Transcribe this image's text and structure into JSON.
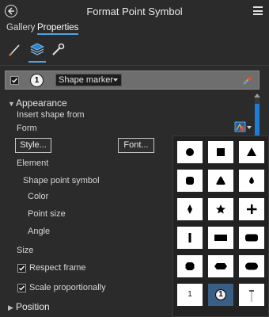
{
  "window": {
    "title": "Format Point Symbol"
  },
  "tabs": [
    {
      "label": "Gallery",
      "active": false
    },
    {
      "label": "Properties",
      "active": true
    }
  ],
  "subtabs": [
    {
      "icon": "brush-icon",
      "active": false
    },
    {
      "icon": "layers-icon",
      "active": true
    },
    {
      "icon": "wrench-icon",
      "active": false
    }
  ],
  "layer": {
    "checked": true,
    "badge": "1",
    "marker_type": "Shape marker"
  },
  "appearance": {
    "section_label": "Appearance",
    "insert_shape_label": "Insert shape from",
    "form_label": "Form",
    "style_button": "Style...",
    "font_button": "Font...",
    "element_label": "Element",
    "shape_point_symbol_label": "Shape point symbol",
    "color_label": "Color",
    "point_size_label": "Point size",
    "angle_label": "Angle",
    "size_label": "Size",
    "respect_frame_label": "Respect frame",
    "respect_frame_checked": true,
    "scale_proportionally_label": "Scale proportionally",
    "scale_proportionally_checked": true
  },
  "sections": {
    "position_label": "Position"
  },
  "shape_gallery": {
    "shapes": [
      "circle-shape",
      "square-shape",
      "triangle-shape",
      "rounded-square-shape",
      "rounded-triangle-shape",
      "teardrop-shape",
      "diamond-shape",
      "star-shape",
      "plus-shape",
      "vertical-bar-shape",
      "rectangle-shape",
      "rounded-rectangle-shape",
      "octagon-shape",
      "hexagon-shape",
      "pill-shape",
      "number-shape",
      "numbered-badge-shape",
      "pin-shape"
    ],
    "number_cell_text": "1",
    "badge_cell_text": "1",
    "selected_index": 16
  },
  "colors": {
    "accent": "#4fa3e0",
    "scroll_thumb": "#1c7fd6",
    "background": "#2b2b2b",
    "selected_cell": "#3a5f86"
  }
}
